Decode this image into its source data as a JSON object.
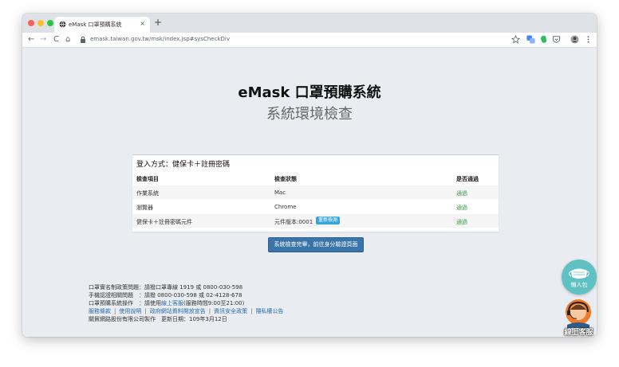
{
  "browser": {
    "tab_title": "eMask 口罩預購系統",
    "tab_close": "×",
    "new_tab": "+",
    "url": "emask.taiwan.gov.tw/msk/index.jsp#sysCheckDiv",
    "nav": {
      "back": "←",
      "forward": "→",
      "reload": "C",
      "home": "⌂"
    }
  },
  "header": {
    "title": "eMask 口罩預購系統",
    "subtitle": "系統環境檢查"
  },
  "check_panel": {
    "login_method": "登入方式：健保卡＋註冊密碼",
    "columns": [
      "檢查項目",
      "檢查狀態",
      "是否通過"
    ],
    "rows": [
      {
        "item": "作業系統",
        "status": "Mac",
        "pass": "通過"
      },
      {
        "item": "瀏覽器",
        "status": "Chrome",
        "pass": "通過"
      },
      {
        "item": "健保卡＋註冊密碼元件",
        "status": "元件版本:0001",
        "pass": "通過",
        "action": "重新檢測"
      }
    ]
  },
  "next_button": "系統檢查完畢，前往身分驗證頁面",
  "footer": {
    "lines": [
      "口罩實名制政策問題：請撥口罩專線 1919 或 0800-030-598",
      "手機認證相關問題　：請撥 0800-030-598 或 02-4128-678"
    ],
    "ops_prefix": "口罩預購系統操作　：請使用",
    "ops_link": "線上客服",
    "ops_suffix": "(服務時間9:00至21:00)",
    "links": [
      "服務條款",
      "使用說明",
      "政府網站資料開放宣告",
      "資訊安全政策",
      "隱私權公告"
    ],
    "link_separator": "|",
    "credit": "關貿網路股份有限公司製作　更新日期：109年3月12日"
  },
  "floating": {
    "badge_label": "懶人包",
    "service_label": "線上客服"
  },
  "colors": {
    "page_bg": "#e9edf1",
    "pass_green": "#3c9c4a",
    "button_blue": "#3a74a8",
    "link_blue": "#2a6aa8",
    "recheck_blue": "#3ba6d6",
    "badge_teal": "#5fc1c2"
  },
  "icons": [
    "globe-icon",
    "lock-icon",
    "star-icon",
    "translate-icon",
    "evernote-icon",
    "pocket-icon",
    "profile-icon",
    "kebab-menu-icon"
  ]
}
